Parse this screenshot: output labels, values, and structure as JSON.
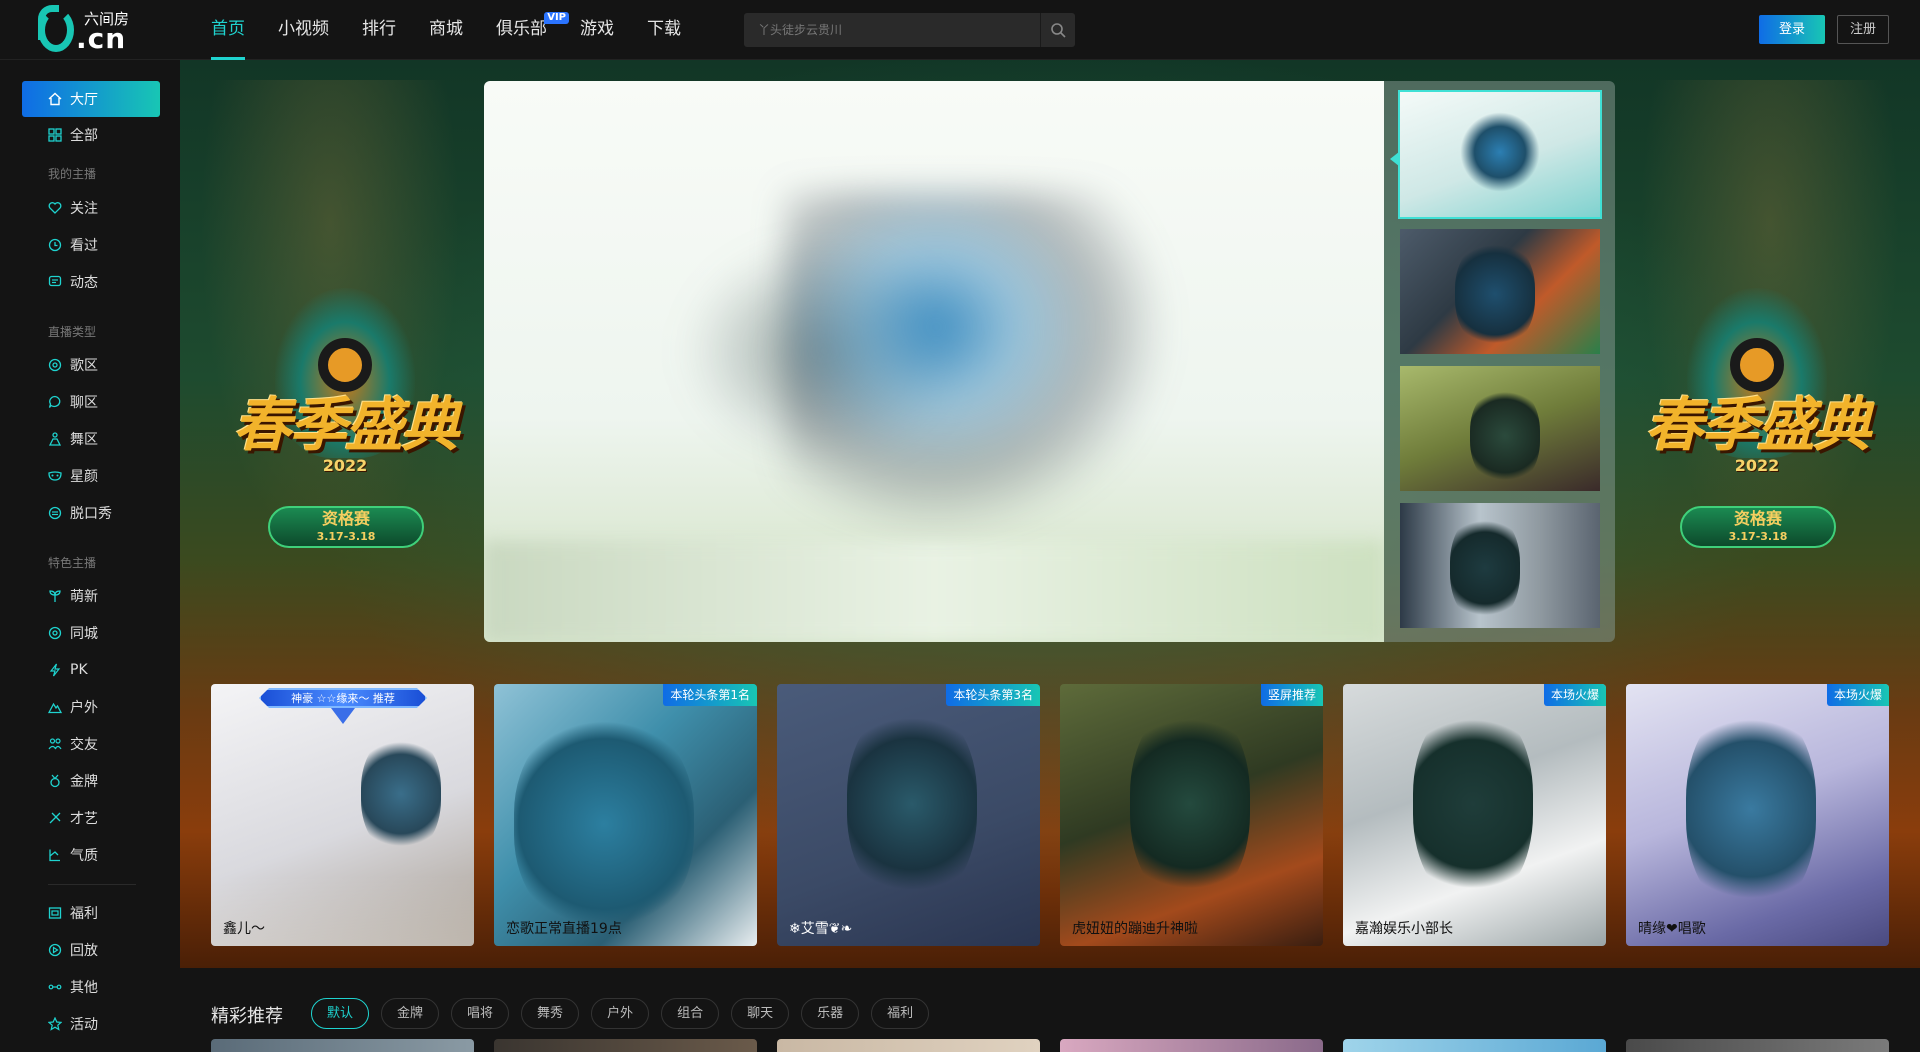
{
  "brand": {
    "logo_text": ".cn",
    "logo_sub": "六间房"
  },
  "nav": {
    "items": [
      {
        "label": "首页",
        "active": true
      },
      {
        "label": "小视频"
      },
      {
        "label": "排行"
      },
      {
        "label": "商城"
      },
      {
        "label": "俱乐部",
        "badge": "VIP"
      },
      {
        "label": "游戏"
      },
      {
        "label": "下载"
      }
    ]
  },
  "search": {
    "placeholder": "丫头徒步云贵川"
  },
  "auth": {
    "login": "登录",
    "register": "注册"
  },
  "sidebar": {
    "items": [
      {
        "label": "大厅",
        "icon": "home-icon",
        "active": true
      },
      {
        "label": "全部",
        "icon": "grid-icon"
      }
    ],
    "my_anchor": {
      "heading": "我的主播",
      "items": [
        {
          "label": "关注",
          "icon": "heart-icon"
        },
        {
          "label": "看过",
          "icon": "clock-icon"
        },
        {
          "label": "动态",
          "icon": "chat-icon"
        }
      ]
    },
    "live_types": {
      "heading": "直播类型",
      "items": [
        {
          "label": "歌区",
          "icon": "music-icon"
        },
        {
          "label": "聊区",
          "icon": "bubble-icon"
        },
        {
          "label": "舞区",
          "icon": "dance-icon"
        },
        {
          "label": "星颜",
          "icon": "mask-icon"
        },
        {
          "label": "脱口秀",
          "icon": "mic-icon"
        }
      ]
    },
    "featured": {
      "heading": "特色主播",
      "items": [
        {
          "label": "萌新",
          "icon": "sprout-icon"
        },
        {
          "label": "同城",
          "icon": "location-icon"
        },
        {
          "label": "PK",
          "icon": "lightning-icon"
        },
        {
          "label": "户外",
          "icon": "mountain-icon"
        },
        {
          "label": "交友",
          "icon": "people-icon"
        },
        {
          "label": "金牌",
          "icon": "medal-icon"
        },
        {
          "label": "才艺",
          "icon": "palette-icon"
        },
        {
          "label": "气质",
          "icon": "hanger-icon"
        }
      ]
    },
    "extra": [
      {
        "label": "福利",
        "icon": "gift-icon"
      },
      {
        "label": "回放",
        "icon": "replay-icon"
      },
      {
        "label": "其他",
        "icon": "dots-icon"
      },
      {
        "label": "活动",
        "icon": "star-icon"
      }
    ]
  },
  "banner": {
    "event_title": "春季盛典",
    "event_year": "2022",
    "event_stage": "资格赛",
    "event_dates": "3.17-3.18"
  },
  "cards": [
    {
      "name": "鑫儿～",
      "crest": "神豪 ☆☆缘来～ 推荐"
    },
    {
      "name": "恋歌正常直播19点",
      "tag": "本轮头条第1名"
    },
    {
      "name": "❄艾雪❦❧",
      "tag": "本轮头条第3名"
    },
    {
      "name": "虎妞妞的蹦迪升神啦",
      "tag": "竖屏推荐"
    },
    {
      "name": "嘉瀚娱乐小部长",
      "tag": "本场火爆"
    },
    {
      "name": "晴缘❤唱歌",
      "tag": "本场火爆"
    }
  ],
  "recommend": {
    "title": "精彩推荐",
    "chips": [
      "默认",
      "金牌",
      "唱将",
      "舞秀",
      "户外",
      "组合",
      "聊天",
      "乐器",
      "福利"
    ],
    "active_chip": "默认"
  },
  "colors": {
    "accent": "#1fd3cf",
    "accent_blue": "#0f6ce6",
    "vip": "#2b74ff"
  }
}
